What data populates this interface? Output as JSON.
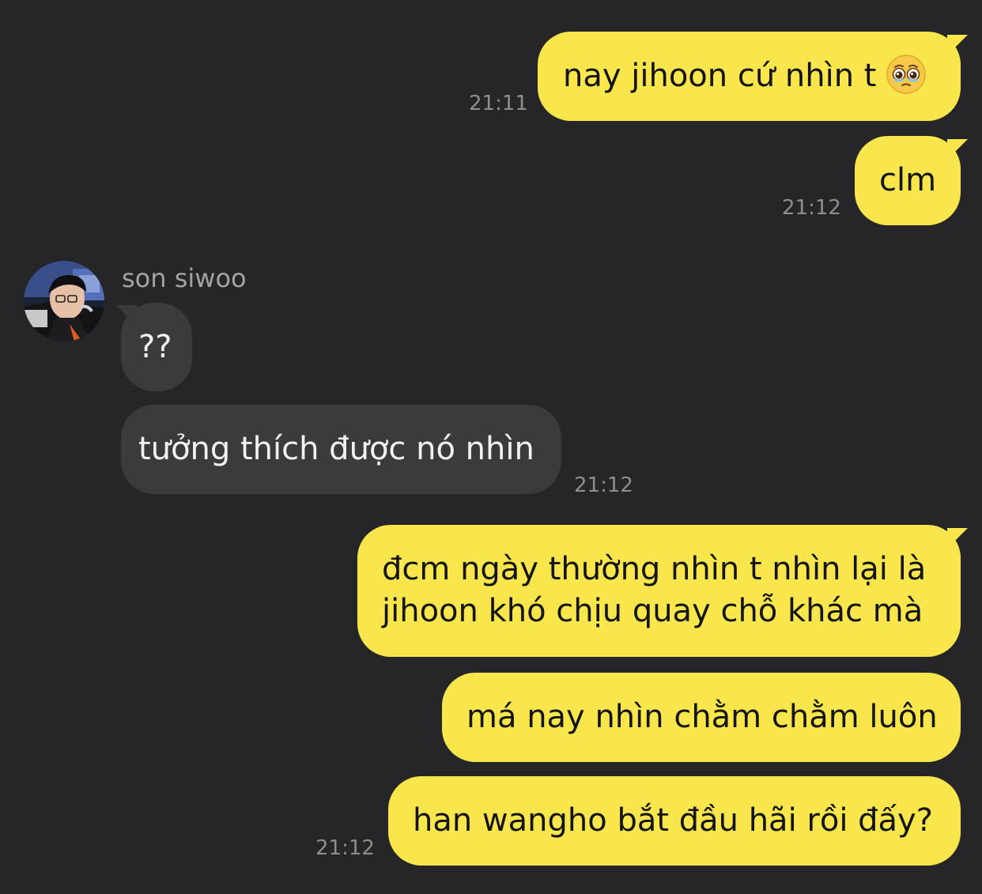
{
  "contact": {
    "name": "son siwoo"
  },
  "messages": [
    {
      "direction": "outgoing",
      "text": "nay jihoon cứ nhìn t",
      "emoji": "pleading-face-with-tears-emoji",
      "time": "21:11"
    },
    {
      "direction": "outgoing",
      "text": "clm",
      "time": "21:12"
    },
    {
      "direction": "incoming",
      "text": "??"
    },
    {
      "direction": "incoming",
      "text": "tưởng thích được nó nhìn",
      "time": "21:12"
    },
    {
      "direction": "outgoing",
      "lines": [
        "đcm ngày thường nhìn t nhìn lại là",
        "jihoon khó chịu quay chỗ khác mà"
      ]
    },
    {
      "direction": "outgoing",
      "text": "má nay nhìn chằm chằm luôn"
    },
    {
      "direction": "outgoing",
      "text": "han wangho bắt đầu hãi rồi đấy?",
      "time": "21:12"
    }
  ],
  "colors": {
    "background": "#262628",
    "outgoing_bubble": "#f9e64c",
    "incoming_bubble": "#3b3b3d",
    "timestamp": "#8e8e92"
  }
}
